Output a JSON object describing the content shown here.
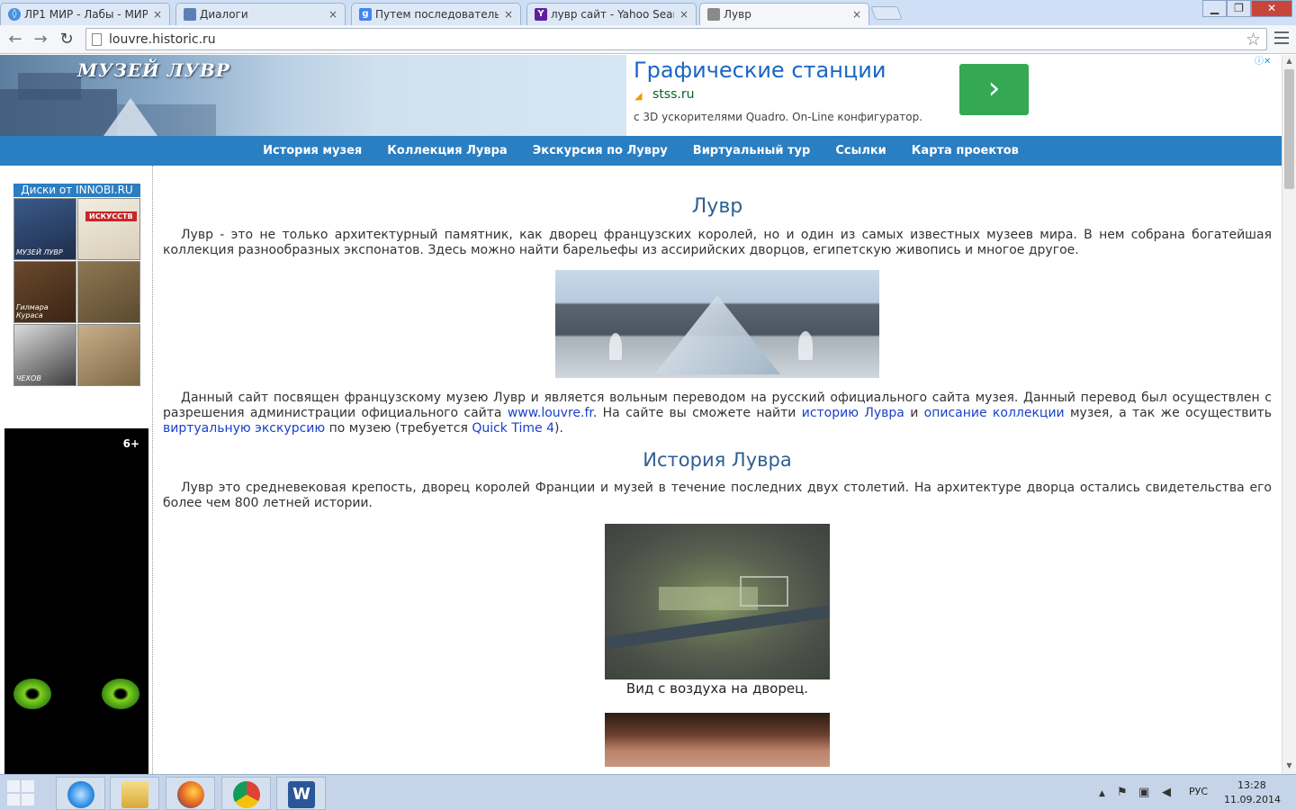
{
  "browser": {
    "tabs": [
      {
        "label": "ЛР1 МИР - Лабы - МИР - ",
        "favicon_color": "#4b8fe0",
        "active": false
      },
      {
        "label": "Диалоги",
        "favicon_color": "#5c7fb5",
        "active": false
      },
      {
        "label": "Путем последовательног",
        "favicon_color": "#4285f4",
        "active": false
      },
      {
        "label": "лувр сайт - Yahoo Search",
        "favicon_color": "#5f1fa0",
        "active": false
      },
      {
        "label": "Лувр",
        "favicon_color": "#8a8a8a",
        "active": true
      }
    ],
    "tab_close": "×",
    "url": "louvre.historic.ru",
    "window": {
      "minimize": "▁",
      "maximize": "❐",
      "close": "✕"
    },
    "nav": {
      "back": "←",
      "forward": "→",
      "reload": "↻",
      "star": "☆"
    }
  },
  "site": {
    "logo": "МУЗЕЙ ЛУВР",
    "nav": [
      "История музея",
      "Коллекция Лувра",
      "Экскурсия по Лувру",
      "Виртуальный тур",
      "Ссылки",
      "Карта проектов"
    ],
    "ad": {
      "title": "Графические станции",
      "domain": "stss.ru",
      "description": "с 3D ускорителями Quadro. On-Line конфигуратор.",
      "cta": "›",
      "choices": "ⓘ✕"
    },
    "sidebar": {
      "discs_title": "Диски от INNOBI.RU",
      "discs": [
        {
          "label": "МУЗЕЙ ЛУВР",
          "color": "#2a3a5a"
        },
        {
          "label": "ИСКУССТВ",
          "color": "#e9e4d8"
        },
        {
          "label": "Гилмара Кураса",
          "color": "#5a3a22"
        },
        {
          "label": "",
          "color": "#7a6544"
        },
        {
          "label": "ЧЕХОВ",
          "color": "#3a3a3a"
        },
        {
          "label": "",
          "color": "#a58c62"
        }
      ],
      "age_rating": "6+"
    },
    "content": {
      "title": "Лувр",
      "intro": "Лувр - это не только архитектурный памятник, как дворец французских королей, но и один из самых известных музеев мира. В нем собрана богатейшая коллекция разнообразных экспонатов. Здесь можно найти барельефы из ассирийских дворцов, египетскую живопись и многое другое.",
      "about_part1": "Данный сайт посвящен французскому музею Лувр и является вольным переводом на русский официального сайта музея. Данный перевод был осуществлен с разрешения администрации официального сайта ",
      "about_link_site": "www.louvre.fr",
      "about_part2": ". На сайте вы сможете найти ",
      "about_link_history": "историю Лувра",
      "about_part3": " и ",
      "about_link_collection": "описание коллекции",
      "about_part4": " музея, а так же осуществить ",
      "about_link_tour": "виртуальную экскурсию",
      "about_part5": " по музею (требуется ",
      "about_link_qt": "Quick Time 4",
      "about_part6": ").",
      "history_title": "История Лувра",
      "history_text": "Лувр это средневековая крепость, дворец королей Франции и музей в течение последних двух столетий. На архитектуре дворца остались свидетельства его более чем 800 летней истории.",
      "aerial_caption": "Вид с воздуха на дворец."
    }
  },
  "taskbar": {
    "apps": [
      {
        "name": "internet-explorer",
        "color": "#2f8de4"
      },
      {
        "name": "file-explorer",
        "color": "#e8c25a"
      },
      {
        "name": "firefox",
        "color": "#e66a1f"
      },
      {
        "name": "chrome",
        "color": "#db4437"
      },
      {
        "name": "word",
        "color": "#2b579a"
      }
    ],
    "tray_arrow": "▲",
    "lang": "РУС",
    "time": "13:28",
    "date": "11.09.2014"
  }
}
